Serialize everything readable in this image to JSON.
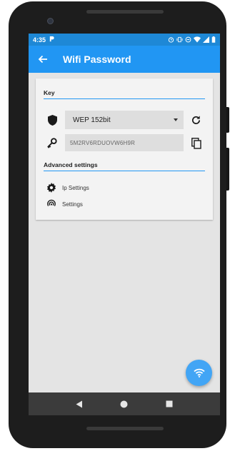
{
  "status_bar": {
    "time": "4:35"
  },
  "app_bar": {
    "title": "Wifi Password"
  },
  "key_section": {
    "title": "Key",
    "encryption_type": "WEP 152bit",
    "key_value": "5M2RV6RDUOVW6H9R"
  },
  "advanced_section": {
    "title": "Advanced settings",
    "items": [
      {
        "label": "Ip Settings",
        "icon": "gear-icon"
      },
      {
        "label": "Settings",
        "icon": "wifi-signal-icon"
      }
    ]
  },
  "fab": {
    "icon": "wifi-icon"
  },
  "colors": {
    "primary": "#2196f3",
    "status_bar": "#1e88d6",
    "fab": "#42a5f5"
  }
}
